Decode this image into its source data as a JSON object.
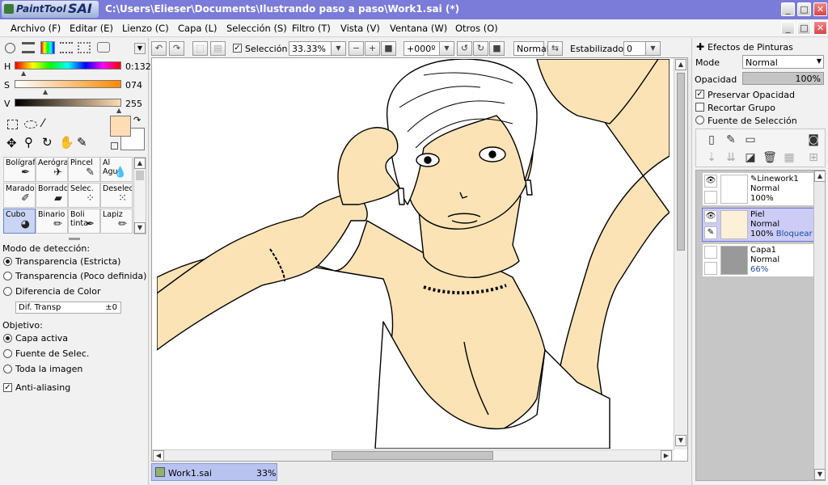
{
  "app": {
    "logo_text": "PaintTool",
    "logo_big": "SAI",
    "title": "C:\\Users\\Elieser\\Documents\\Ilustrando paso a paso\\Work1.sai (*)"
  },
  "window_buttons": {
    "minimize": "_",
    "maximize": "□",
    "close": "✕"
  },
  "menu": [
    "Archivo (F)",
    "Editar (E)",
    "Lienzo (C)",
    "Capa (L)",
    "Selección (S)",
    "Filtro (T)",
    "Vista (V)",
    "Ventana (W)",
    "Otros (O)"
  ],
  "color": {
    "h_label": "H",
    "h_value": "0:132",
    "s_label": "S",
    "s_value": "074",
    "v_label": "V",
    "v_value": "255",
    "h_level": 0.06,
    "s_level": 0.29,
    "v_level": 1.0,
    "primary": "#ffdcb4",
    "secondary": "#ffffff"
  },
  "tools": [
    {
      "label": "Bolígrafo",
      "icon": "pen-icon"
    },
    {
      "label": "Aerógraf",
      "icon": "airbrush-icon"
    },
    {
      "label": "Pincel",
      "icon": "brush-icon"
    },
    {
      "label": "Al Agua",
      "icon": "water-icon"
    },
    {
      "label": "Marador",
      "icon": "marker-icon"
    },
    {
      "label": "Borrador",
      "icon": "eraser-icon"
    },
    {
      "label": "Selec.",
      "icon": "select-brush-icon"
    },
    {
      "label": "Deselec.",
      "icon": "deselect-brush-icon"
    },
    {
      "label": "Cubo",
      "icon": "bucket-icon"
    },
    {
      "label": "Binario",
      "icon": "binary-pen-icon"
    },
    {
      "label": "Boli tinta",
      "icon": "ink-pen-icon"
    },
    {
      "label": "Lapiz",
      "icon": "pencil-icon"
    }
  ],
  "selected_tool": "Cubo",
  "detection": {
    "title": "Modo de detección:",
    "options": [
      "Transparencia (Estricta)",
      "Transparencia (Poco definida)",
      "Diferencia de Color"
    ],
    "selected": 0,
    "field_label": "Dif. Transp",
    "field_value": "±0"
  },
  "target": {
    "title": "Objetivo:",
    "options": [
      "Capa activa",
      "Fuente de Selec.",
      "Toda la imagen"
    ],
    "selected": 0
  },
  "antialias": {
    "label": "Anti-aliasing",
    "checked": true
  },
  "canvas_toolbar": {
    "selection_label": "Selección",
    "selection_checked": true,
    "zoom": "33.33%",
    "rotation": "+000º",
    "blend": "Normal",
    "stabilizer_label": "Estabilizador",
    "stabilizer_value": "0"
  },
  "document_tab": {
    "name": "Work1.sai",
    "zoom": "33%"
  },
  "effects": {
    "title": "Efectos de Pinturas",
    "mode_label": "Mode",
    "mode_value": "Normal",
    "opacity_label": "Opacidad",
    "opacity_value": "100%",
    "preserve_label": "Preservar Opacidad",
    "preserve_checked": true,
    "clip_label": "Recortar Grupo",
    "clip_checked": false,
    "source_label": "Fuente de Selección",
    "source_checked": false
  },
  "layers": [
    {
      "name": "Linework1",
      "mode": "Normal",
      "opacity": "100%",
      "extra": "",
      "visible": true,
      "selected": false
    },
    {
      "name": "Piel",
      "mode": "Normal",
      "opacity": "100%",
      "extra": "Bloquear",
      "visible": true,
      "selected": true
    },
    {
      "name": "Capa1",
      "mode": "Normal",
      "opacity": "66%",
      "extra": "",
      "visible": false,
      "selected": false
    }
  ],
  "colors": {
    "titlebar": "#7b7bd9",
    "skin": "#fbe3b6",
    "selected_layer": "#ccccf7",
    "line": "#000000"
  }
}
